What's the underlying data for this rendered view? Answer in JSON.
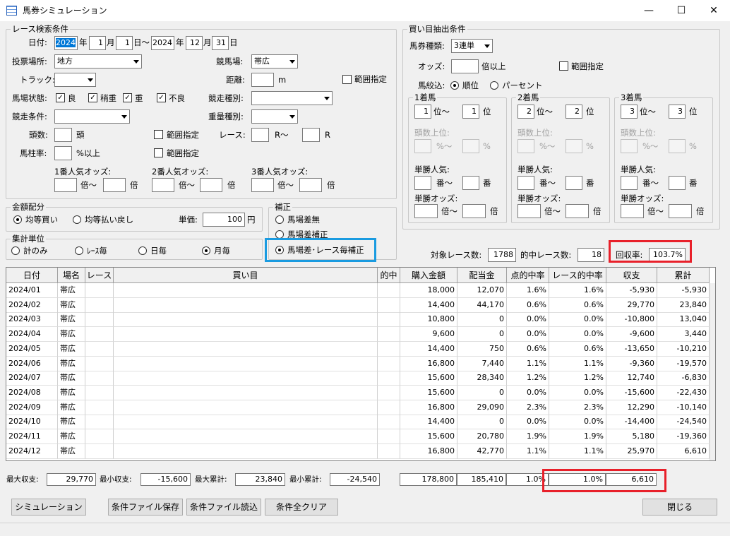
{
  "window": {
    "title": "馬券シミュレーション",
    "minimize": "—",
    "maximize": "☐",
    "close": "✕"
  },
  "race": {
    "legend": "レース検索条件",
    "date_label": "日付:",
    "from_year": "2024",
    "y1": "年",
    "from_month": "1",
    "m1": "月",
    "from_day": "1",
    "d1": "日～",
    "to_year": "2024",
    "y2": "年",
    "to_month": "12",
    "m2": "月",
    "to_day": "31",
    "d2": "日",
    "venue_label": "投票場所:",
    "venue_value": "地方",
    "track_label": "競馬場:",
    "track_value": "帯広",
    "course_label": "トラック:",
    "course_value": "",
    "distance_label": "距離:",
    "distance_value": "",
    "distance_unit": "m",
    "range1": "範囲指定",
    "condition_label": "馬場状態:",
    "cond1": "良",
    "cond2": "稍重",
    "cond3": "重",
    "cond4": "不良",
    "race_type_label": "競走種別:",
    "race_type_value": "",
    "race_cond_label": "競走条件:",
    "race_cond_value": "",
    "weight_label": "重量種別:",
    "weight_value": "",
    "heads_label": "頭数:",
    "heads_unit": "頭",
    "range2": "範囲指定",
    "race_label": "レース:",
    "race_from": "R～",
    "race_to": "R",
    "post_label": "馬柱率:",
    "post_unit": "%以上",
    "range3": "範囲指定",
    "fav1_label": "1番人気オッズ:",
    "fav2_label": "2番人気オッズ:",
    "fav3_label": "3番人気オッズ:",
    "bai_from": "倍～",
    "bai_to": "倍"
  },
  "money": {
    "legend": "金額配分",
    "opt1": "均等買い",
    "opt2": "均等払い戻し",
    "unit_label": "単価:",
    "unit_value": "100",
    "unit_suffix": "円"
  },
  "agg": {
    "legend": "集計単位",
    "opt1": "計のみ",
    "opt2": "ﾚｰｽ毎",
    "opt3": "日毎",
    "opt4": "月毎"
  },
  "correction": {
    "legend": "補正",
    "opt1": "馬場差無",
    "opt2": "馬場差補正",
    "opt3": "馬場差･レース毎補正"
  },
  "bet": {
    "legend": "買い目抽出条件",
    "type_label": "馬券種類:",
    "type_value": "3連単",
    "odds_label": "オッズ:",
    "odds_unit": "倍以上",
    "range": "範囲指定",
    "filter_label": "馬絞込:",
    "filter_opt1": "順位",
    "filter_opt2": "パーセント",
    "pos_from_label": "位～",
    "pos_to_label": "位",
    "heads_top": "頭数上位:",
    "pct_from": "%～",
    "pct_to": "%",
    "pop_label": "単勝人気:",
    "ban_from": "番～",
    "ban_to": "番",
    "odds2_label": "単勝オッズ:",
    "bai_from": "倍～",
    "bai_to": "倍",
    "groups": [
      {
        "title": "1着馬",
        "from": "1",
        "to": "1"
      },
      {
        "title": "2着馬",
        "from": "2",
        "to": "2"
      },
      {
        "title": "3着馬",
        "from": "3",
        "to": "3"
      }
    ]
  },
  "summary": {
    "races_label": "対象レース数:",
    "races_value": "1788",
    "hit_label": "的中レース数:",
    "hit_value": "18",
    "return_label": "回収率:",
    "return_value": "103.7%"
  },
  "table": {
    "headers": [
      "日付",
      "場名",
      "レース",
      "買い目",
      "的中",
      "購入金額",
      "配当金",
      "点的中率",
      "レース的中率",
      "収支",
      "累計"
    ],
    "rows": [
      [
        "2024/01",
        "帯広",
        "",
        "",
        "",
        "18,000",
        "12,070",
        "1.6%",
        "1.6%",
        "-5,930",
        "-5,930"
      ],
      [
        "2024/02",
        "帯広",
        "",
        "",
        "",
        "14,400",
        "44,170",
        "0.6%",
        "0.6%",
        "29,770",
        "23,840"
      ],
      [
        "2024/03",
        "帯広",
        "",
        "",
        "",
        "10,800",
        "0",
        "0.0%",
        "0.0%",
        "-10,800",
        "13,040"
      ],
      [
        "2024/04",
        "帯広",
        "",
        "",
        "",
        "9,600",
        "0",
        "0.0%",
        "0.0%",
        "-9,600",
        "3,440"
      ],
      [
        "2024/05",
        "帯広",
        "",
        "",
        "",
        "14,400",
        "750",
        "0.6%",
        "0.6%",
        "-13,650",
        "-10,210"
      ],
      [
        "2024/06",
        "帯広",
        "",
        "",
        "",
        "16,800",
        "7,440",
        "1.1%",
        "1.1%",
        "-9,360",
        "-19,570"
      ],
      [
        "2024/07",
        "帯広",
        "",
        "",
        "",
        "15,600",
        "28,340",
        "1.2%",
        "1.2%",
        "12,740",
        "-6,830"
      ],
      [
        "2024/08",
        "帯広",
        "",
        "",
        "",
        "15,600",
        "0",
        "0.0%",
        "0.0%",
        "-15,600",
        "-22,430"
      ],
      [
        "2024/09",
        "帯広",
        "",
        "",
        "",
        "16,800",
        "29,090",
        "2.3%",
        "2.3%",
        "12,290",
        "-10,140"
      ],
      [
        "2024/10",
        "帯広",
        "",
        "",
        "",
        "14,400",
        "0",
        "0.0%",
        "0.0%",
        "-14,400",
        "-24,540"
      ],
      [
        "2024/11",
        "帯広",
        "",
        "",
        "",
        "15,600",
        "20,780",
        "1.9%",
        "1.9%",
        "5,180",
        "-19,360"
      ],
      [
        "2024/12",
        "帯広",
        "",
        "",
        "",
        "16,800",
        "42,770",
        "1.1%",
        "1.1%",
        "25,970",
        "6,610"
      ]
    ]
  },
  "footer": {
    "max_label": "最大収支:",
    "max_value": "29,770",
    "min_label": "最小収支:",
    "min_value": "-15,600",
    "maxcum_label": "最大累計:",
    "maxcum_value": "23,840",
    "mincum_label": "最小累計:",
    "mincum_value": "-24,540",
    "total_buy": "178,800",
    "total_pay": "185,410",
    "total_pt": "1.0%",
    "total_race": "1.0%",
    "total_cum": "6,610"
  },
  "buttons": {
    "simulate": "シミュレーション",
    "save": "条件ファイル保存",
    "load": "条件ファイル読込",
    "clear": "条件全クリア",
    "close": "閉じる"
  },
  "colors": {
    "highlight_red": "#e8202a",
    "highlight_blue": "#1a9be0",
    "selection": "#0078d7"
  }
}
